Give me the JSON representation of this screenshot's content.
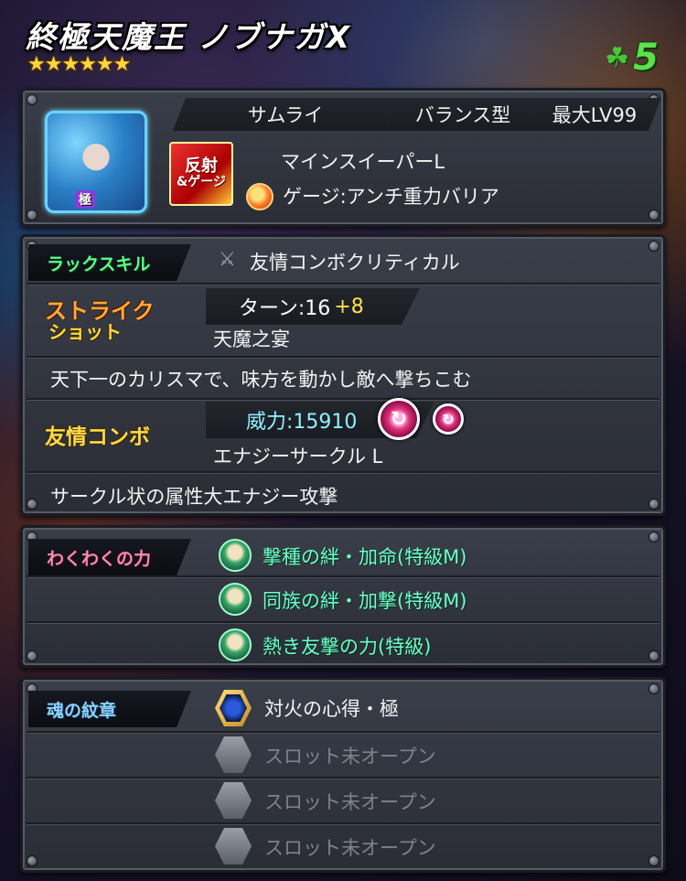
{
  "header": {
    "title": "終極天魔王 ノブナガX",
    "stars": "★★★★★★",
    "luck_icon": "clover-icon",
    "luck_value": "5"
  },
  "profile": {
    "avatar_badge": "極",
    "tag_race": "サムライ",
    "tag_type": "バランス型",
    "tag_level": "最大LV99",
    "gauge_icon_line1": "反射",
    "gauge_icon_line2": "&ゲージ",
    "ability": "マインスイーパーL",
    "gauge_ability": "ゲージ:アンチ重力バリア"
  },
  "skills": {
    "luck_label": "ラックスキル",
    "luck_skill": "友情コンボクリティカル",
    "strike_label_1": "ストライク",
    "strike_label_2": "ショット",
    "turn_label": "ターン:16",
    "turn_plus": "+8",
    "strike_name": "天魔之宴",
    "strike_desc": "天下一のカリスマで、味方を動かし敵へ撃ちこむ",
    "friend_label": "友情コンボ",
    "power": "威力:15910",
    "friend_name": "エナジーサークル L",
    "friend_desc": "サークル状の属性大エナジー攻撃"
  },
  "waku": {
    "label": "わくわくの力",
    "items": [
      "撃種の絆・加命(特級M)",
      "同族の絆・加撃(特級M)",
      "熱き友撃の力(特級)"
    ]
  },
  "emblem": {
    "label": "魂の紋章",
    "main": "対火の心得・極",
    "slots": [
      "スロット未オープン",
      "スロット未オープン",
      "スロット未オープン"
    ]
  }
}
